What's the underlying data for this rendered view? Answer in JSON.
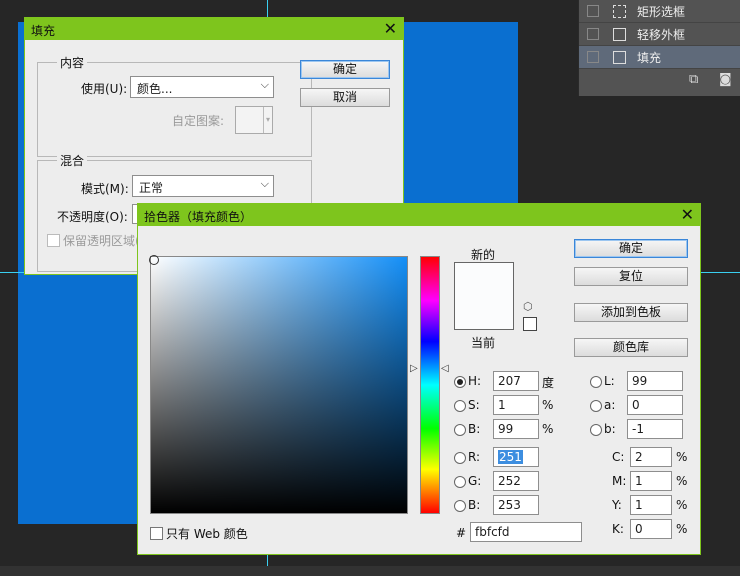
{
  "layers": {
    "items": [
      {
        "name": "矩形选框",
        "selected": false
      },
      {
        "name": "轻移外框",
        "selected": false
      },
      {
        "name": "填充",
        "selected": true
      }
    ]
  },
  "fill_dialog": {
    "title": "填充",
    "close_glyph": "✕",
    "ok_label": "确定",
    "cancel_label": "取消",
    "content_group": "内容",
    "use_label": "使用(U):",
    "use_value": "颜色...",
    "custom_pattern_label": "自定图案:",
    "blend_group": "混合",
    "mode_label": "模式(M):",
    "mode_value": "正常",
    "opacity_label": "不透明度(O):",
    "preserve_label": "保留透明区域("
  },
  "color_picker": {
    "title": "拾色器（填充颜色）",
    "close_glyph": "✕",
    "new_label": "新的",
    "current_label": "当前",
    "ok_label": "确定",
    "reset_label": "复位",
    "add_swatch_label": "添加到色板",
    "color_library_label": "颜色库",
    "web_only_label": "只有 Web 颜色",
    "new_color": "#fbfcfd",
    "current_color": "#fbfcfd",
    "hsb": {
      "h_label": "H:",
      "h_value": "207",
      "h_unit": "度",
      "s_label": "S:",
      "s_value": "1",
      "s_unit": "%",
      "b_label": "B:",
      "b_value": "99",
      "b_unit": "%"
    },
    "rgb": {
      "r_label": "R:",
      "r_value": "251",
      "g_label": "G:",
      "g_value": "252",
      "b_label": "B:",
      "b_value": "253"
    },
    "lab": {
      "l_label": "L:",
      "l_value": "99",
      "a_label": "a:",
      "a_value": "0",
      "b_label": "b:",
      "b_value": "-1"
    },
    "cmyk": {
      "c_label": "C:",
      "c_value": "2",
      "c_unit": "%",
      "m_label": "M:",
      "m_value": "1",
      "m_unit": "%",
      "y_label": "Y:",
      "y_value": "1",
      "y_unit": "%",
      "k_label": "K:",
      "k_value": "0",
      "k_unit": "%"
    },
    "hex_label": "#",
    "hex_value": "fbfcfd"
  },
  "colors": {
    "canvas_blue": "#0a6fd0",
    "title_green": "#7ec51d"
  }
}
